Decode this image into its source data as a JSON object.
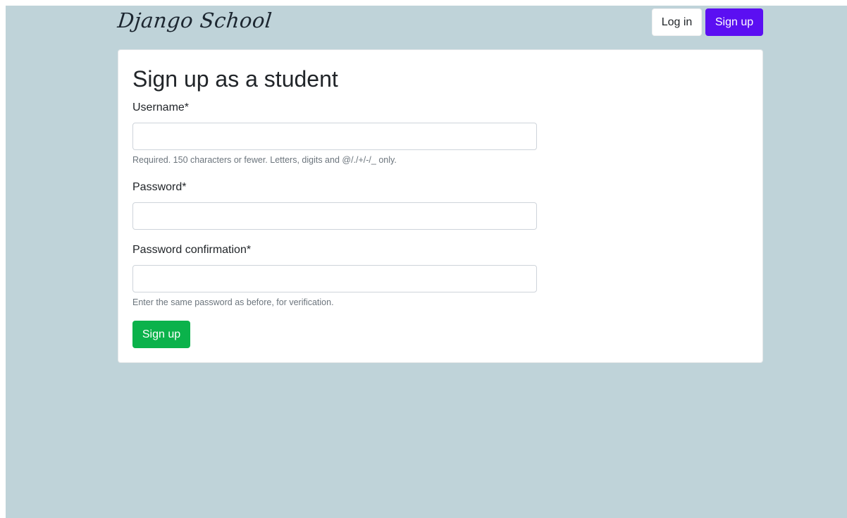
{
  "navbar": {
    "brand": "Django School",
    "login_label": "Log in",
    "signup_label": "Sign up"
  },
  "form": {
    "title": "Sign up as a student",
    "username": {
      "label": "Username*",
      "value": "",
      "help": "Required. 150 characters or fewer. Letters, digits and @/./+/-/_ only."
    },
    "password": {
      "label": "Password*",
      "value": ""
    },
    "password_confirmation": {
      "label": "Password confirmation*",
      "value": "",
      "help": "Enter the same password as before, for verification."
    },
    "submit_label": "Sign up"
  },
  "colors": {
    "background": "#bfd3d9",
    "nav_signup": "#5b0ff2",
    "submit": "#0bb24b"
  }
}
